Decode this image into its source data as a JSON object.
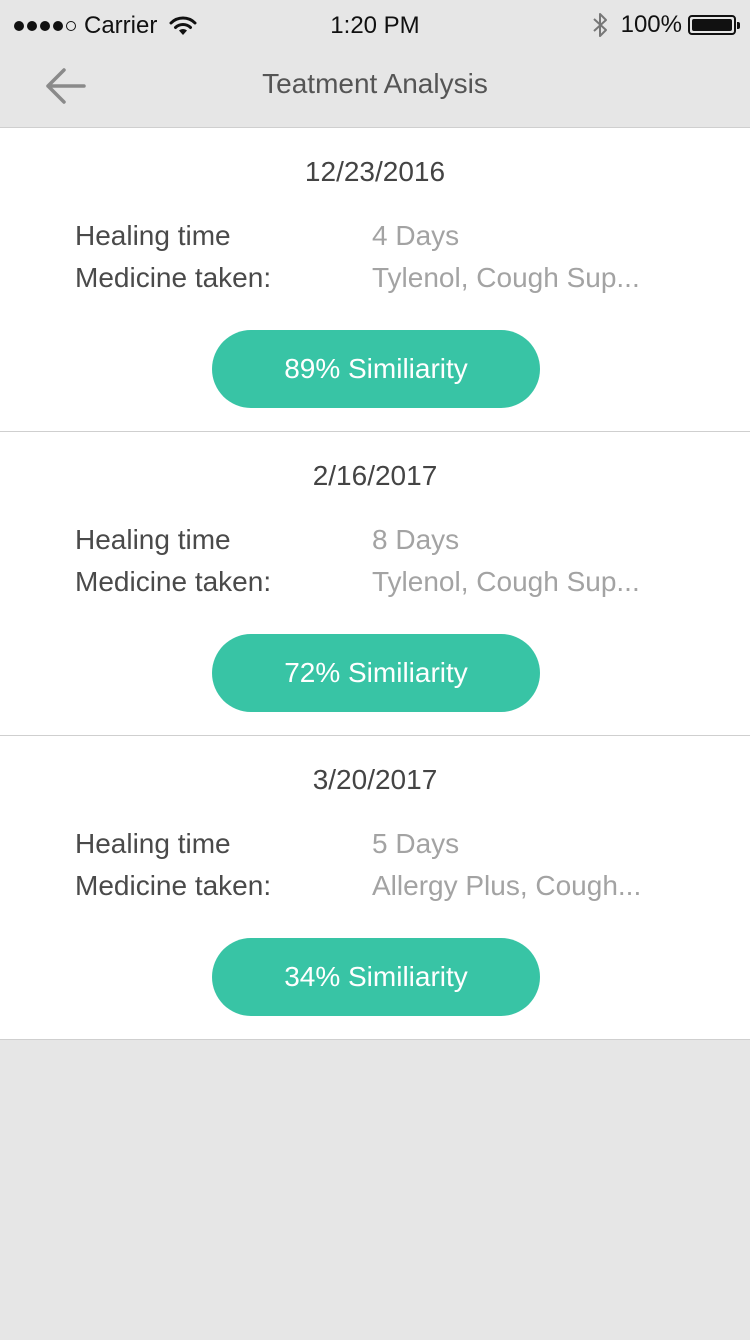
{
  "status_bar": {
    "carrier": "Carrier",
    "time": "1:20 PM",
    "battery": "100%",
    "signal_bars_filled": 4,
    "signal_bars_total": 5
  },
  "nav": {
    "title": "Teatment Analysis",
    "back_icon": "back-arrow-icon"
  },
  "colors": {
    "accent": "#38c4a5",
    "background": "#e6e6e6",
    "card": "#ffffff"
  },
  "records": [
    {
      "date": "12/23/2016",
      "healing_label": "Healing time",
      "healing_value": "4 Days",
      "medicine_label": "Medicine taken:",
      "medicine_value": "Tylenol, Cough Sup...",
      "similarity": "89% Similiarity"
    },
    {
      "date": "2/16/2017",
      "healing_label": "Healing time",
      "healing_value": "8 Days",
      "medicine_label": "Medicine taken:",
      "medicine_value": "Tylenol, Cough Sup...",
      "similarity": "72% Similiarity"
    },
    {
      "date": "3/20/2017",
      "healing_label": "Healing time",
      "healing_value": "5 Days",
      "medicine_label": "Medicine taken:",
      "medicine_value": "Allergy Plus, Cough...",
      "similarity": "34% Similiarity"
    }
  ]
}
